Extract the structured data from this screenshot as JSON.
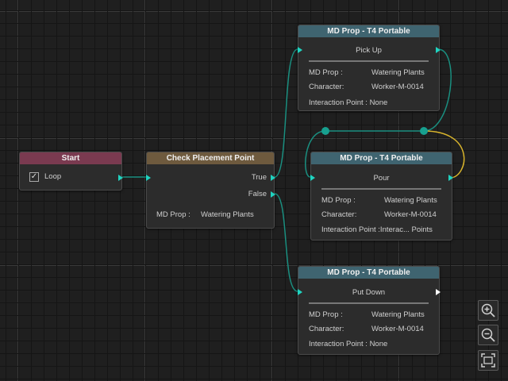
{
  "nodes": {
    "start": {
      "title": "Start",
      "loop_label": "Loop",
      "loop_checked": "✓"
    },
    "check": {
      "title": "Check Placement Point",
      "true_label": "True",
      "false_label": "False",
      "prop_label": "MD Prop :",
      "prop_value": "Watering Plants"
    },
    "pickup": {
      "title": "MD Prop - T4 Portable",
      "action": "Pick Up",
      "prop_label": "MD Prop :",
      "prop_value": "Watering Plants",
      "character_label": "Character:",
      "character_value": "Worker-M-0014",
      "point_label": "Interaction Point : None"
    },
    "pour": {
      "title": "MD Prop - T4 Portable",
      "action": "Pour",
      "prop_label": "MD Prop :",
      "prop_value": "Watering Plants",
      "character_label": "Character:",
      "character_value": "Worker-M-0014",
      "point_label": "Interaction Point :Interac... Points"
    },
    "putdown": {
      "title": "MD Prop - T4 Portable",
      "action": "Put Down",
      "prop_label": "MD Prop :",
      "prop_value": "Watering Plants",
      "character_label": "Character:",
      "character_value": "Worker-M-0014",
      "point_label": "Interaction Point : None"
    }
  },
  "toolbar": {
    "zoom_in_icon": "zoom-in-icon",
    "zoom_out_icon": "zoom-out-icon",
    "fit_icon": "fit-view-icon"
  },
  "colors": {
    "wire": "#1a8f80",
    "wire_highlight": "#d8b42c",
    "port": "#20d3c0",
    "start_header": "#7a3a50",
    "check_header": "#6e5a3e",
    "prop_header": "#3f6470"
  }
}
